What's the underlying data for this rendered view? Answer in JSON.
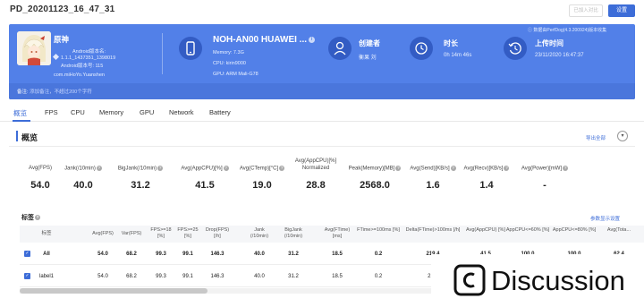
{
  "header": {
    "title": "PD_20201123_16_47_31",
    "compare_label": "已加入对比",
    "settings_label": "设置"
  },
  "app": {
    "name": "原神",
    "android_version_label": "Android版本名:",
    "version_name": "1.1.1_1437351_1398019",
    "android_code_label": "Android版本号: 115",
    "package": "com.miHoYo.Yuanshen"
  },
  "device": {
    "name": "NOH-AN00 HUAWEI ...",
    "memory": "Memory: 7.3G",
    "cpu": "CPU: kirin9000",
    "gpu": "GPU: ARM Mali-G78"
  },
  "meta": {
    "creator_label": "创建者",
    "creator_value": "衡果 刘",
    "duration_label": "时长",
    "duration_value": "0h 14m 46s",
    "upload_label": "上传时间",
    "upload_value": "23/11/2020 16:47:37",
    "sdk_note": "ⓘ 数据由PerfDog(4.3.200924)版本收集"
  },
  "note": {
    "label": "备注:",
    "placeholder": "添加备注，不超过200个字符"
  },
  "tabs": [
    "概览",
    "FPS",
    "CPU",
    "Memory",
    "GPU",
    "Network",
    "Battery"
  ],
  "overview": {
    "title": "概览",
    "export_label": "导出全部",
    "stats": [
      {
        "label": "Avg(FPS)",
        "value": "54.0"
      },
      {
        "label": "Jank(/10min)",
        "value": "40.0"
      },
      {
        "label": "BigJank(/10min)",
        "value": "31.2"
      },
      {
        "label": "Avg(AppCPU)[%]",
        "value": "41.5"
      },
      {
        "label": "Avg(CTemp)[°C]",
        "value": "19.0"
      },
      {
        "label": "Avg(AppCPU)[%] Normalized",
        "value": "28.8"
      },
      {
        "label": "Peak(Memory)[MB]",
        "value": "2568.0"
      },
      {
        "label": "Avg(Send)[KB/s]",
        "value": "1.6"
      },
      {
        "label": "Avg(Recv)[KB/s]",
        "value": "1.4"
      },
      {
        "label": "Avg(Power)[mW]",
        "value": "-"
      }
    ]
  },
  "tags": {
    "title": "标签",
    "settings_label": "参数显示设置",
    "columns": [
      "标签",
      "Avg(FPS)",
      "Var(FPS)",
      "FPS>=18 [%]",
      "FPS>=25 [%]",
      "Drop(FPS) [/h]",
      "Jank (/10min)",
      "BigJank (/10min)",
      "Avg(FTime) [ms]",
      "FTime>=100ms [%]",
      "Delta(FTime)>100ms [/h]",
      "Avg(AppCPU) [%]",
      "AppCPU<=60% [%]",
      "AppCPU<=80% [%]",
      "Avg(Tota..."
    ],
    "rows": [
      {
        "label": "All",
        "cells": [
          "54.0",
          "68.2",
          "99.3",
          "99.1",
          "146.3",
          "40.0",
          "31.2",
          "18.5",
          "0.2",
          "219.4",
          "41.5",
          "100.0",
          "100.0",
          "62.4"
        ]
      },
      {
        "label": "label1",
        "cells": [
          "54.0",
          "68.2",
          "99.3",
          "99.1",
          "146.3",
          "40.0",
          "31.2",
          "18.5",
          "0.2",
          "21...",
          "",
          "",
          "",
          ""
        ]
      }
    ]
  },
  "watermark": {
    "text": "Discussion"
  },
  "colors": {
    "accent": "#3d6dd8",
    "banner": "#5280e8"
  }
}
